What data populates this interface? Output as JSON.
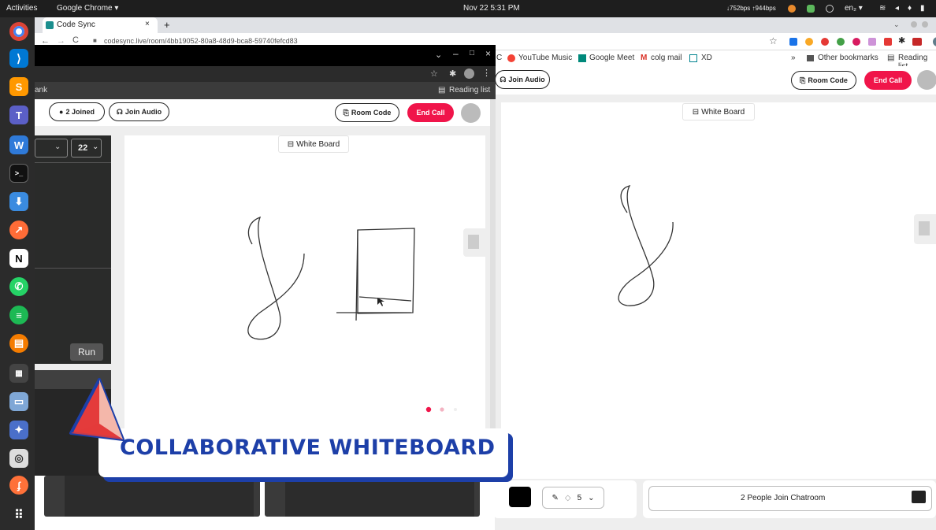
{
  "topbar": {
    "activities": "Activities",
    "app": "Google Chrome ▾",
    "datetime": "Nov 22  5:31 PM",
    "net": "↓752bps ↑944bps",
    "lang": "en₂ ▾"
  },
  "back_browser": {
    "tab_title": "Code Sync",
    "url": "codesync.live/room/4bb19052-80a8-48d9-bca8-59740fefcd83",
    "bookmarks": [
      "YouTube Music",
      "Google Meet",
      "colg mail",
      "XD"
    ],
    "bookmarks_more": "»",
    "other_bookmarks": "Other bookmarks",
    "reading_list": "Reading list",
    "join_audio": "Join Audio",
    "room_code": "Room Code",
    "end_call": "End Call",
    "whiteboard_label": "White Board",
    "brush_size": "5",
    "chatroom": "2 People Join Chatroom"
  },
  "small_browser": {
    "reading_list": "Reading list",
    "left_stub": "ank",
    "joined": "2 Joined",
    "join_audio": "Join Audio",
    "room_code": "Room Code",
    "end_call": "End Call",
    "font_size": "22",
    "run": "Run",
    "whiteboard_label": "White Board"
  },
  "banner": {
    "title": "COLLABORATIVE WHITEBOARD"
  },
  "colors": {
    "end_call": "#f0154a",
    "banner_blue": "#1d3fa8",
    "banner_logo_red": "#e43b3b",
    "banner_logo_pink": "#f4b7aa"
  },
  "dock_icons": [
    "chrome-icon",
    "vscode-icon",
    "sublime-icon",
    "teams-icon",
    "wps-icon",
    "terminal-icon",
    "files-icon",
    "postman-icon",
    "notion-icon",
    "whatsapp-icon",
    "spotify-icon",
    "books-icon",
    "calculator-icon",
    "scanner-icon",
    "flatpak-icon",
    "screenshot-icon",
    "firefox-icon",
    "apps-grid-icon"
  ]
}
